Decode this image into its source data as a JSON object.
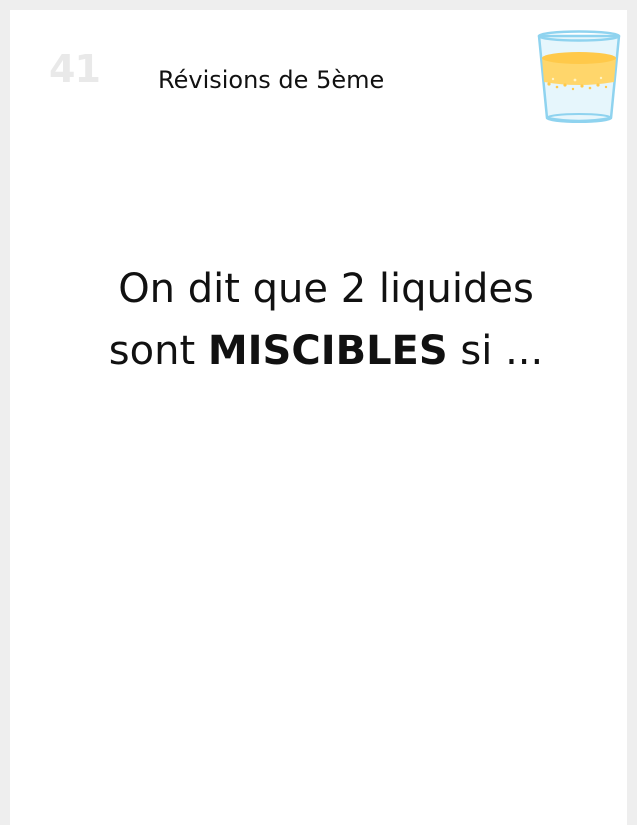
{
  "card": {
    "number": "41",
    "header": "Révisions de 5ème"
  },
  "question": {
    "line1": "On dit que 2 liquides",
    "line2_prefix": "sont ",
    "line2_emphasis": "MISCIBLES",
    "line2_suffix": " si ..."
  },
  "illustration": {
    "icon": "glass-of-liquid-icon",
    "colors": {
      "glass_outline": "#8fd3ef",
      "glass_fill": "#e6f6fc",
      "liquid": "#ffd66b",
      "liquid_top": "#ffc94a"
    }
  },
  "colors": {
    "background": "#eeeeee",
    "card": "#ffffff",
    "number": "#e9e9e9",
    "text": "#111111"
  }
}
